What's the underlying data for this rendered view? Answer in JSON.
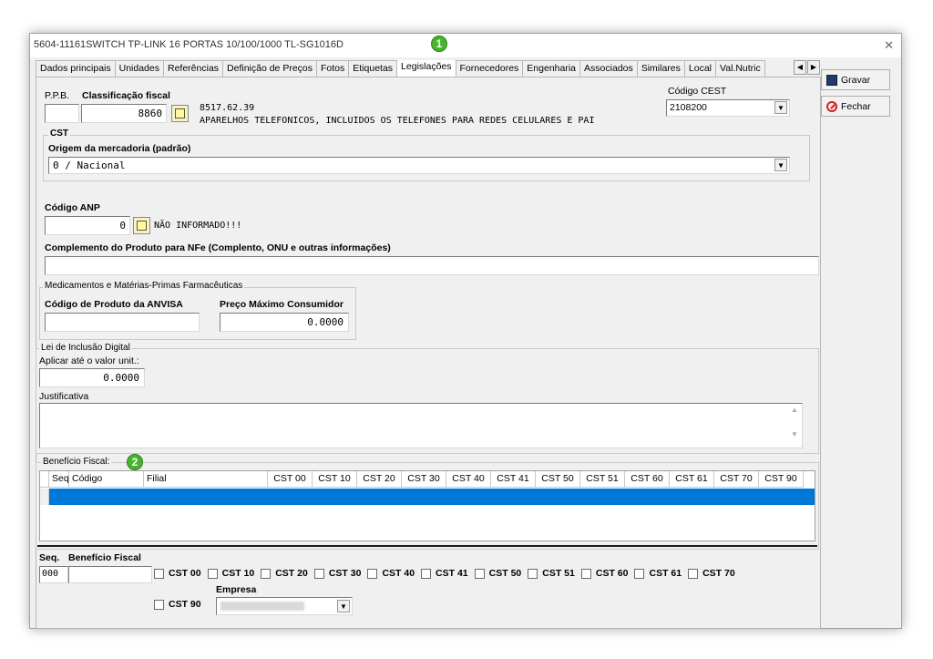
{
  "window": {
    "title": "5604-11161SWITCH TP-LINK 16 PORTAS 10/100/1000 TL-SG1016D",
    "close_glyph": "✕"
  },
  "tabs": [
    {
      "label": "Dados principais",
      "active": false
    },
    {
      "label": "Unidades",
      "active": false
    },
    {
      "label": "Referências",
      "active": false
    },
    {
      "label": "Definição de Preços",
      "active": false
    },
    {
      "label": "Fotos",
      "active": false
    },
    {
      "label": "Etiquetas",
      "active": false
    },
    {
      "label": "Legislações",
      "active": true
    },
    {
      "label": "Fornecedores",
      "active": false
    },
    {
      "label": "Engenharia",
      "active": false
    },
    {
      "label": "Associados",
      "active": false
    },
    {
      "label": "Similares",
      "active": false
    },
    {
      "label": "Local",
      "active": false
    },
    {
      "label": "Val.Nutric",
      "active": false
    }
  ],
  "badges": {
    "one": "1",
    "two": "2"
  },
  "buttons": {
    "save": "Gravar",
    "close": "Fechar"
  },
  "fiscal": {
    "ppb_label": "P.P.B.",
    "ppb_value": "",
    "class_label": "Classificação fiscal",
    "class_value": "8860",
    "ncm_code": "8517.62.39",
    "ncm_desc": "APARELHOS TELEFÔNICOS, INCLUÍDOS OS TELEFONES PARA REDES CELULARES E PAI",
    "cest_label": "Código CEST",
    "cest_value": "2108200"
  },
  "cst": {
    "group_label": "CST",
    "origin_label": "Origem da mercadoria (padrão)",
    "origin_value": "0 / Nacional"
  },
  "anp": {
    "label": "Código ANP",
    "value": "0",
    "desc": "NÃO INFORMADO!!!"
  },
  "complement": {
    "label": "Complemento do Produto para NFe (Complento, ONU e outras informações)",
    "value": ""
  },
  "anvisa": {
    "group_label": "Medicamentos e Matérias-Primas Farmacêuticas",
    "code_label": "Código de Produto da ANVISA",
    "code_value": "",
    "price_label": "Preço Máximo Consumidor",
    "price_value": "0.0000"
  },
  "digital": {
    "group_label": "Lei de Inclusão Digital",
    "apply_label": "Aplicar até o valor unit.:",
    "apply_value": "0.0000",
    "just_label": "Justificativa",
    "just_value": ""
  },
  "benefit": {
    "group_label": "Benefício Fiscal:",
    "columns": [
      "Seq.",
      "Código",
      "Filial",
      "CST 00",
      "CST 10",
      "CST 20",
      "CST 30",
      "CST 40",
      "CST 41",
      "CST 50",
      "CST 51",
      "CST 60",
      "CST 61",
      "CST 70",
      "CST 90"
    ],
    "seq_label": "Seq.",
    "seq_value": "000",
    "benefit_label": "Benefício Fiscal",
    "benefit_value": "",
    "checkboxes": [
      "CST 00",
      "CST 10",
      "CST 20",
      "CST 30",
      "CST 40",
      "CST 41",
      "CST 50",
      "CST 51",
      "CST 60",
      "CST 61",
      "CST 70"
    ],
    "checkbox_cst90": "CST 90",
    "empresa_label": "Empresa",
    "empresa_value": ""
  },
  "colors": {
    "selection": "#0078d7",
    "window_bg": "#f0f0f0",
    "badge": "#47b52a"
  }
}
